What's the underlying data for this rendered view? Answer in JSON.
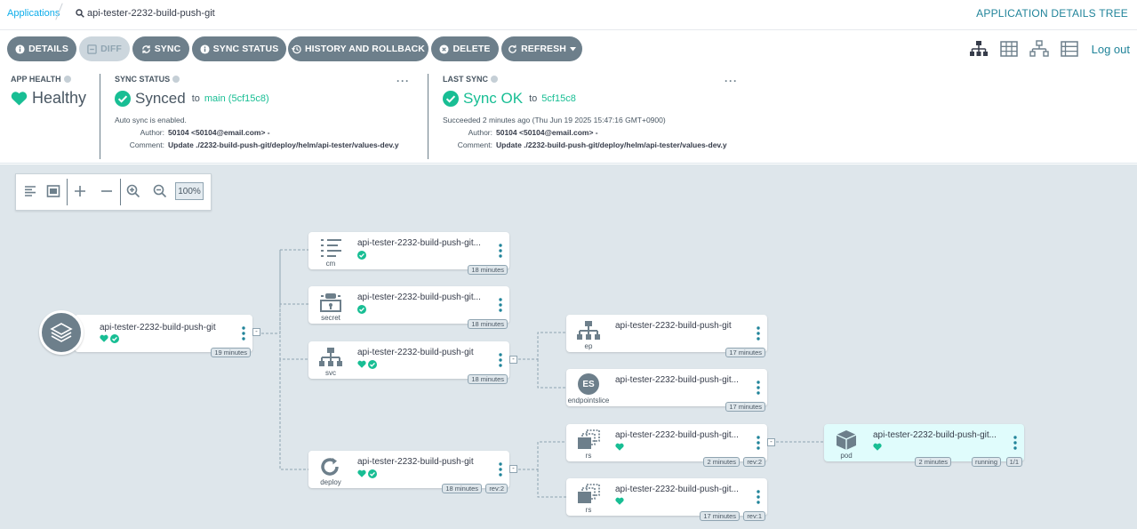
{
  "breadcrumb": {
    "root": "Applications",
    "current": "api-tester-2232-build-push-git"
  },
  "page_title": "APPLICATION DETAILS TREE",
  "toolbar": {
    "details": "DETAILS",
    "diff": "DIFF",
    "sync": "SYNC",
    "sync_status": "SYNC STATUS",
    "history": "HISTORY AND ROLLBACK",
    "delete": "DELETE",
    "refresh": "REFRESH",
    "logout": "Log out"
  },
  "app_health": {
    "label": "APP HEALTH",
    "value": "Healthy"
  },
  "sync_status": {
    "label": "SYNC STATUS",
    "value": "Synced",
    "to": "to",
    "target": "main (5cf15c8)",
    "note": "Auto sync is enabled.",
    "author_label": "Author:",
    "author": "50104 <50104@email.com> -",
    "comment_label": "Comment:",
    "comment": "Update ./2232-build-push-git/deploy/helm/api-tester/values-dev.y",
    "more": "···"
  },
  "last_sync": {
    "label": "LAST SYNC",
    "value": "Sync OK",
    "to": "to",
    "target": "5cf15c8",
    "note": "Succeeded 2 minutes ago (Thu Jun 19 2025 15:47:16 GMT+0900)",
    "author_label": "Author:",
    "author": "50104 <50104@email.com> -",
    "comment_label": "Comment:",
    "comment": "Update ./2232-build-push-git/deploy/helm/api-tester/values-dev.y",
    "more": "···"
  },
  "zoom": "100%",
  "app_node": {
    "name": "api-tester-2232-build-push-git",
    "age": "19 minutes"
  },
  "nodes": {
    "cm": {
      "name": "api-tester-2232-build-push-git...",
      "kind": "cm",
      "age": "18 minutes"
    },
    "secret": {
      "name": "api-tester-2232-build-push-git...",
      "kind": "secret",
      "age": "18 minutes"
    },
    "svc": {
      "name": "api-tester-2232-build-push-git",
      "kind": "svc",
      "age": "18 minutes"
    },
    "deploy": {
      "name": "api-tester-2232-build-push-git",
      "kind": "deploy",
      "age": "18 minutes",
      "rev": "rev:2"
    },
    "ep": {
      "name": "api-tester-2232-build-push-git",
      "kind": "ep",
      "age": "17 minutes"
    },
    "endpointslice": {
      "name": "api-tester-2232-build-push-git...",
      "kind": "endpointslice",
      "icon_text": "ES",
      "age": "17 minutes"
    },
    "rs2": {
      "name": "api-tester-2232-build-push-git...",
      "kind": "rs",
      "age": "2 minutes",
      "rev": "rev:2"
    },
    "rs1": {
      "name": "api-tester-2232-build-push-git...",
      "kind": "rs",
      "age": "17 minutes",
      "rev": "rev:1"
    },
    "pod": {
      "name": "api-tester-2232-build-push-git...",
      "kind": "pod",
      "age": "2 minutes",
      "state": "running",
      "ready": "1/1"
    }
  },
  "colors": {
    "healthy": "#18be94",
    "button": "#6d7f8b",
    "graph_bg": "#dee6eb",
    "link": "#0dadea"
  }
}
